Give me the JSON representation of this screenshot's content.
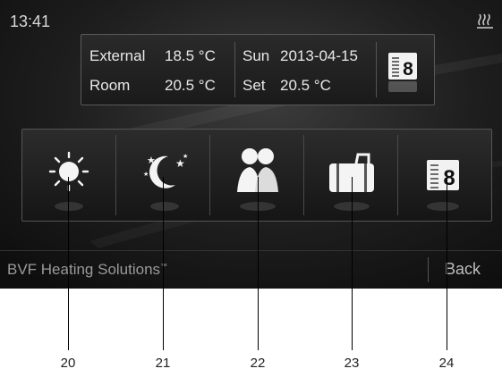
{
  "status_bar": {
    "time": "13:41",
    "heating_indicator": "heating-coil-icon"
  },
  "info_panel": {
    "external_label": "External",
    "external_value": "18.5 °C",
    "room_label": "Room",
    "room_value": "20.5 °C",
    "day": "Sun",
    "date": "2013-04-15",
    "set_label": "Set",
    "set_value": "20.5 °C",
    "program_icon": "program-8-icon"
  },
  "modes": [
    {
      "icon": "sun-icon",
      "callout": "20"
    },
    {
      "icon": "moon-stars-icon",
      "callout": "21"
    },
    {
      "icon": "people-icon",
      "callout": "22"
    },
    {
      "icon": "suitcase-icon",
      "callout": "23"
    },
    {
      "icon": "program-8-icon",
      "callout": "24"
    }
  ],
  "footer": {
    "brand": "BVF Heating Solutions",
    "trademark": "™",
    "back_label": "Back"
  },
  "colors": {
    "screen_bg": "#1e1e1e",
    "text": "#e8e8e8",
    "muted": "#9a9a9a"
  }
}
